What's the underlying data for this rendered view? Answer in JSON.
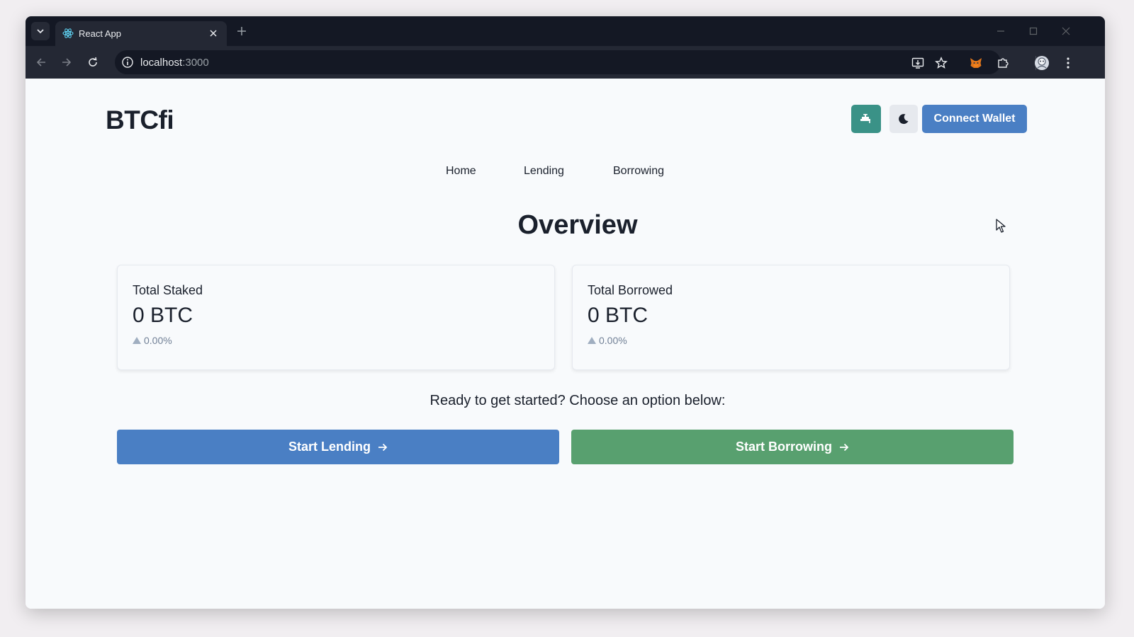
{
  "browser": {
    "tab_title": "React App",
    "url_host": "localhost",
    "url_port": ":3000"
  },
  "app": {
    "logo": "BTCfi",
    "connect_wallet_label": "Connect Wallet",
    "nav": [
      "Home",
      "Lending",
      "Borrowing"
    ],
    "overview_title": "Overview",
    "cards": [
      {
        "label": "Total Staked",
        "value": "0 BTC",
        "change": "0.00%"
      },
      {
        "label": "Total Borrowed",
        "value": "0 BTC",
        "change": "0.00%"
      }
    ],
    "prompt": "Ready to get started? Choose an option below:",
    "start_lending_label": "Start Lending",
    "start_borrowing_label": "Start Borrowing"
  },
  "colors": {
    "primary_blue": "#4a7fc4",
    "primary_green": "#58a06f",
    "faucet_teal": "#3a9287"
  },
  "icons": {
    "faucet_button": "faucet-icon",
    "theme_button": "moon-icon",
    "action_arrow": "arrow-right-icon"
  }
}
